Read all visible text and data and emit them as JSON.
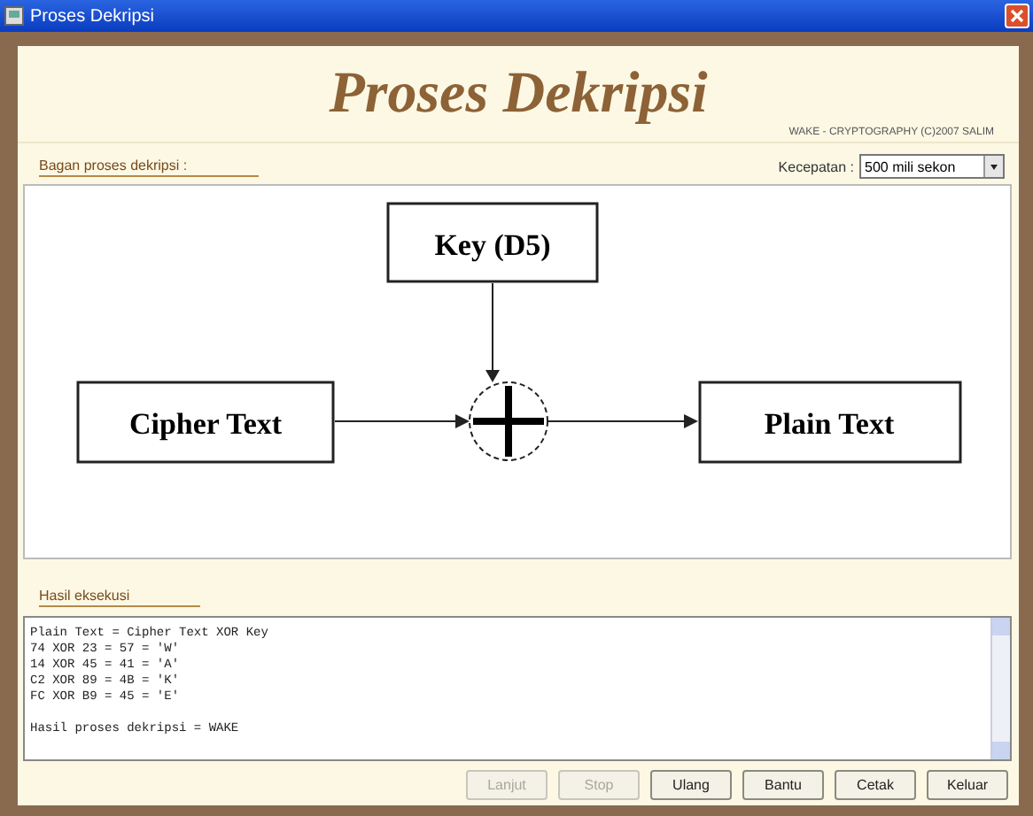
{
  "window": {
    "title": "Proses Dekripsi"
  },
  "header": {
    "title": "Proses Dekripsi",
    "credit": "WAKE - CRYPTOGRAPHY (C)2007 SALIM"
  },
  "process_section": {
    "label": "Bagan proses dekripsi :",
    "speed_label": "Kecepatan :",
    "speed_value": "500 mili sekon"
  },
  "diagram": {
    "key": "Key (D5)",
    "input": "Cipher Text",
    "output": "Plain Text"
  },
  "result_section": {
    "label": "Hasil eksekusi",
    "lines": [
      "Plain Text = Cipher Text XOR Key",
      "74 XOR 23 = 57 = 'W'",
      "14 XOR 45 = 41 = 'A'",
      "C2 XOR 89 = 4B = 'K'",
      "FC XOR B9 = 45 = 'E'"
    ],
    "summary": "Hasil proses dekripsi = WAKE"
  },
  "buttons": [
    {
      "label": "Lanjut",
      "disabled": true
    },
    {
      "label": "Stop",
      "disabled": true
    },
    {
      "label": "Ulang",
      "disabled": false
    },
    {
      "label": "Bantu",
      "disabled": false
    },
    {
      "label": "Cetak",
      "disabled": false
    },
    {
      "label": "Keluar",
      "disabled": false
    }
  ]
}
